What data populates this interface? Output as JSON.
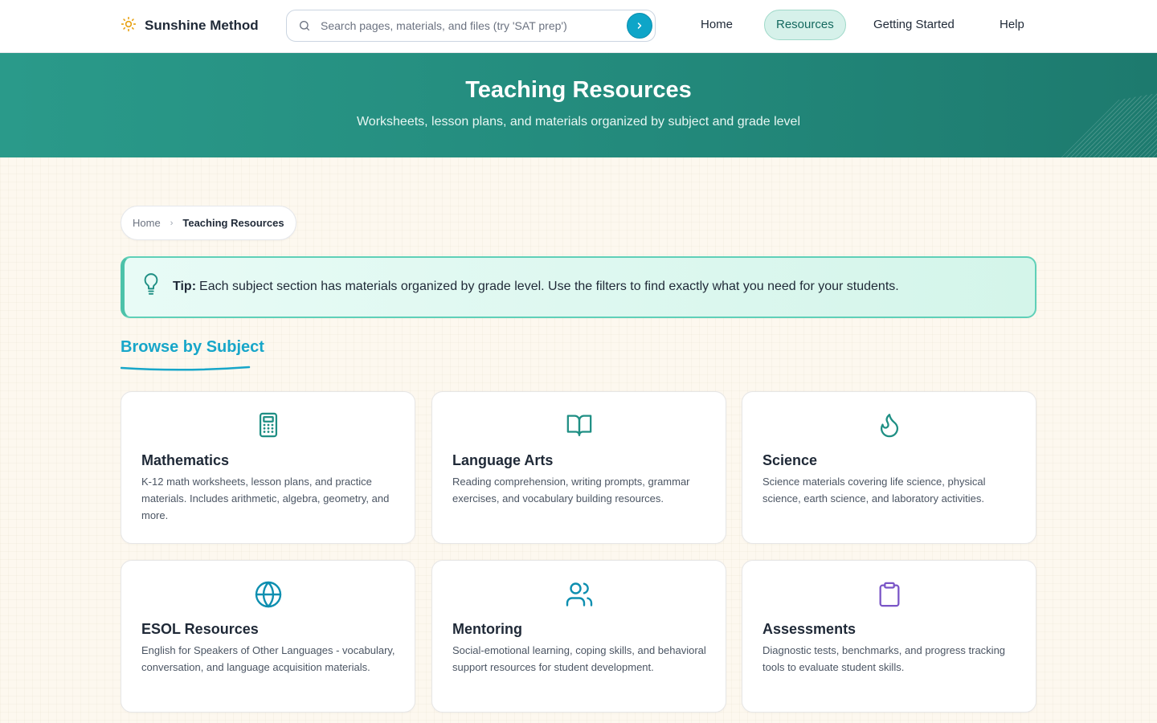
{
  "header": {
    "brand": "Sunshine Method",
    "search_placeholder": "Search pages, materials, and files (try 'SAT prep')",
    "nav": [
      {
        "label": "Home"
      },
      {
        "label": "Resources",
        "active": true
      },
      {
        "label": "Getting Started"
      },
      {
        "label": "Help"
      }
    ]
  },
  "hero": {
    "title": "Teaching Resources",
    "subtitle": "Worksheets, lesson plans, and materials organized by subject and grade level"
  },
  "breadcrumb": {
    "home": "Home",
    "current": "Teaching Resources"
  },
  "tip": {
    "label": "Tip:",
    "text": "Each subject section has materials organized by grade level. Use the filters to find exactly what you need for your students."
  },
  "section": {
    "title": "Browse by Subject"
  },
  "subjects": [
    {
      "icon": "calculator-icon",
      "color": "#1f8f84",
      "title": "Mathematics",
      "description": "K-12 math worksheets, lesson plans, and practice materials. Includes arithmetic, algebra, geometry, and more."
    },
    {
      "icon": "book-open-icon",
      "color": "#1f8f84",
      "title": "Language Arts",
      "description": "Reading comprehension, writing prompts, grammar exercises, and vocabulary building resources."
    },
    {
      "icon": "flame-icon",
      "color": "#1f8f84",
      "title": "Science",
      "description": "Science materials covering life science, physical science, earth science, and laboratory activities."
    },
    {
      "icon": "globe-icon",
      "color": "#0e8fb0",
      "title": "ESOL Resources",
      "description": "English for Speakers of Other Languages - vocabulary, conversation, and language acquisition materials."
    },
    {
      "icon": "users-icon",
      "color": "#0e8fb0",
      "title": "Mentoring",
      "description": "Social-emotional learning, coping skills, and behavioral support resources for student development."
    },
    {
      "icon": "clipboard-icon",
      "color": "#7a55c7",
      "title": "Assessments",
      "description": "Diagnostic tests, benchmarks, and progress tracking tools to evaluate student skills."
    }
  ],
  "colors": {
    "accent": "#17a6c9",
    "hero": "#238a7c",
    "tip_border": "#5fd0b8",
    "sun": "#e8a317"
  }
}
